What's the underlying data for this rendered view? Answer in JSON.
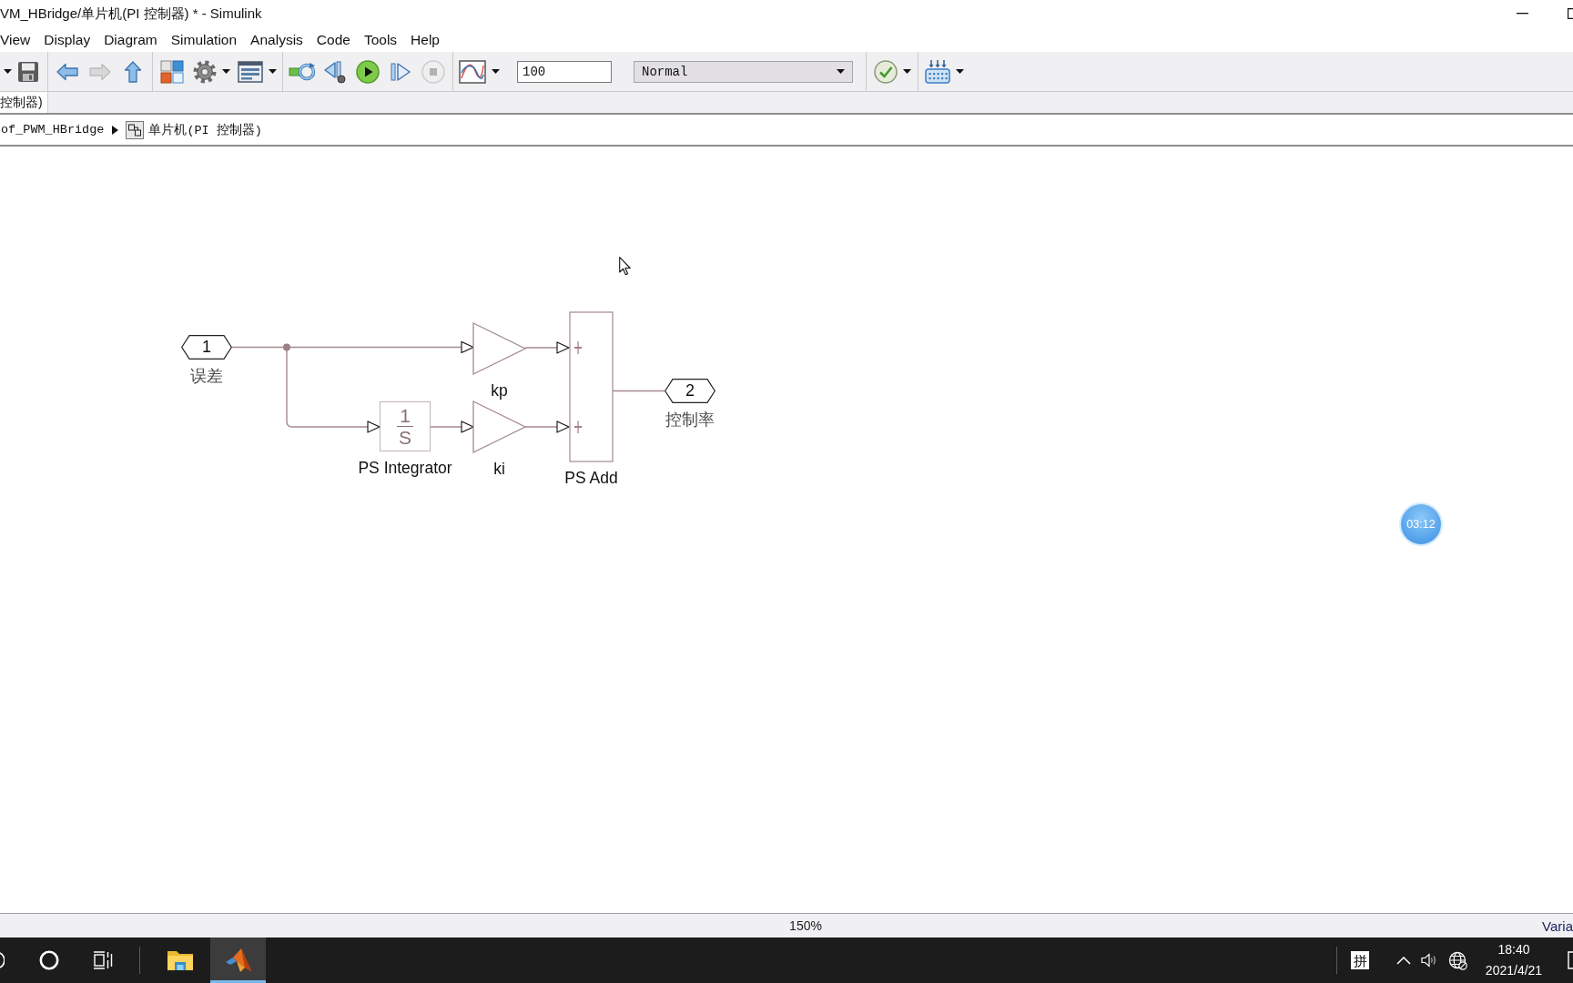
{
  "window": {
    "title": "VM_HBridge/单片机(PI 控制器) * - Simulink"
  },
  "menu": [
    "View",
    "Display",
    "Diagram",
    "Simulation",
    "Analysis",
    "Code",
    "Tools",
    "Help"
  ],
  "toolbar": {
    "groups": [
      [
        {
          "kind": "caret",
          "disabled": false,
          "dropdown": false
        },
        {
          "kind": "save",
          "disabled": false,
          "dropdown": false
        }
      ],
      [
        {
          "kind": "back",
          "disabled": false,
          "dropdown": false
        },
        {
          "kind": "forward",
          "disabled": true,
          "dropdown": false
        },
        {
          "kind": "up",
          "disabled": false,
          "dropdown": false
        }
      ],
      [
        {
          "kind": "library",
          "disabled": false,
          "dropdown": false
        },
        {
          "kind": "settings",
          "disabled": false,
          "dropdown": true
        },
        {
          "kind": "explorer",
          "disabled": false,
          "dropdown": true
        }
      ],
      [
        {
          "kind": "update",
          "disabled": false,
          "dropdown": false
        },
        {
          "kind": "step-back",
          "disabled": false,
          "dropdown": false
        },
        {
          "kind": "run",
          "disabled": false,
          "dropdown": false
        },
        {
          "kind": "step-forward",
          "disabled": false,
          "dropdown": false
        },
        {
          "kind": "stop",
          "disabled": true,
          "dropdown": false
        }
      ],
      [
        {
          "kind": "scope",
          "disabled": false,
          "dropdown": true
        },
        {
          "kind": "stop-time",
          "value": "100",
          "disabled": false,
          "dropdown": false
        },
        {
          "kind": "mode",
          "value": "Normal",
          "disabled": false,
          "dropdown": true
        }
      ],
      [
        {
          "kind": "check",
          "disabled": false,
          "dropdown": true
        }
      ],
      [
        {
          "kind": "build",
          "disabled": false,
          "dropdown": true
        }
      ]
    ]
  },
  "tabs": [
    {
      "label": "控制器)",
      "selected": true
    }
  ],
  "breadcrumb": [
    {
      "kind": "model",
      "label": "of_PWM_HBridge"
    },
    {
      "kind": "subsystem",
      "label": "单片机(PI 控制器)"
    }
  ],
  "diagram": {
    "ports": [
      {
        "number": "1",
        "label": "误差"
      },
      {
        "number": "2",
        "label": "控制率"
      }
    ],
    "blocks": [
      {
        "kind": "gain",
        "label": "kp"
      },
      {
        "kind": "integrator",
        "label": "PS Integrator",
        "numerator": "1",
        "denominator": "S"
      },
      {
        "kind": "gain",
        "label": "ki"
      },
      {
        "kind": "sum",
        "label": "PS Add",
        "signs": [
          "+",
          "+"
        ]
      }
    ]
  },
  "status_bar": {
    "zoom": "150%",
    "solver": "Varia"
  },
  "taskbar": {
    "apps": [
      {
        "kind": "file-explorer",
        "selected": false
      },
      {
        "kind": "matlab",
        "selected": true
      }
    ],
    "ime": "拼",
    "time": "18:40",
    "date": "2021/4/21"
  },
  "overlay": {
    "timer": "03:12"
  }
}
